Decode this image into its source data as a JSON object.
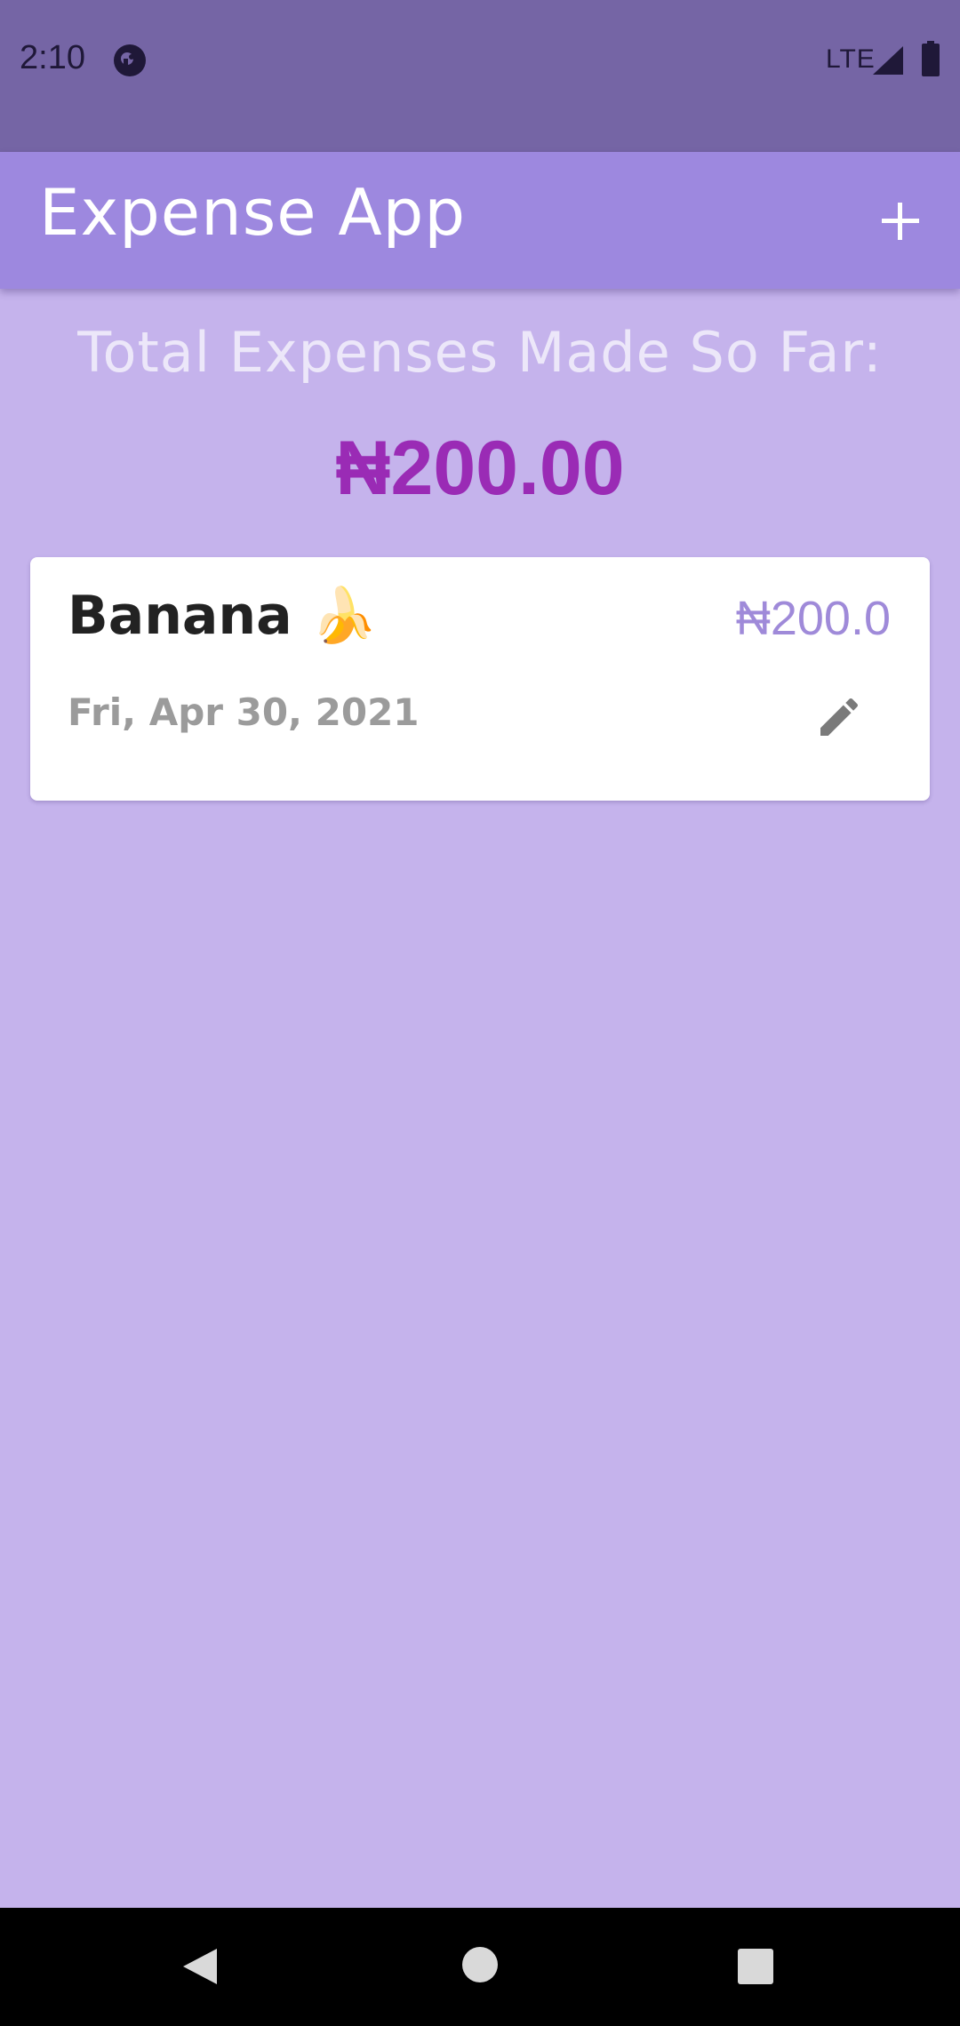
{
  "status_bar": {
    "time": "2:10",
    "network": "LTE",
    "icons": [
      "app-notification-icon",
      "signal-icon",
      "battery-icon"
    ]
  },
  "app_bar": {
    "title": "Expense App",
    "add_icon": "plus-icon"
  },
  "summary": {
    "label": "Total Expenses Made So Far:",
    "total": "₦200.00"
  },
  "expenses": [
    {
      "title": "Banana 🍌",
      "amount": "₦200.0",
      "date": "Fri, Apr 30, 2021",
      "edit_icon": "pencil-icon"
    }
  ],
  "nav_bar": {
    "icons": [
      "back-icon",
      "home-icon",
      "recents-icon"
    ]
  },
  "colors": {
    "background": "#c5b3ec",
    "status_bar": "#7565a5",
    "app_bar": "#9d88df",
    "total_amount": "#9a2bb5",
    "card_amount": "#9f8ad9"
  }
}
